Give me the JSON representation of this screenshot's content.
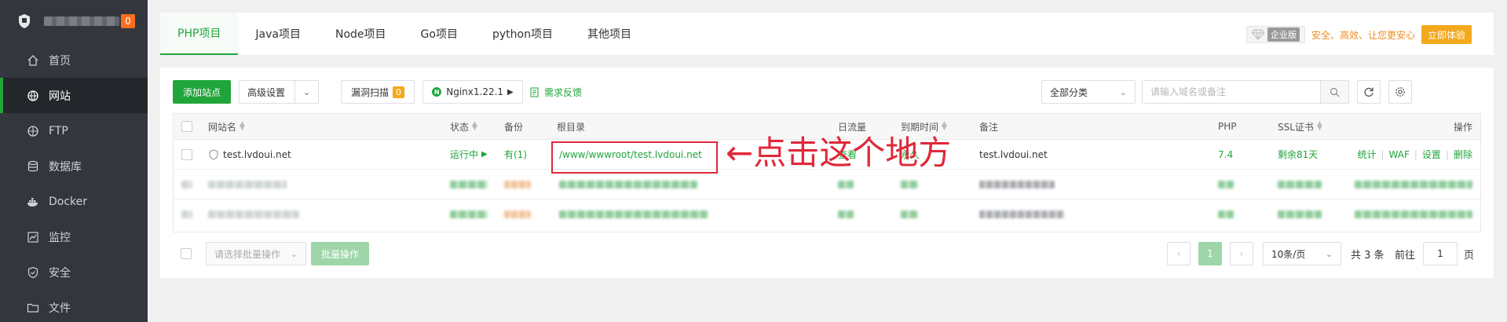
{
  "sidebar": {
    "badge": "0",
    "items": [
      {
        "label": "首页",
        "icon": "home-icon"
      },
      {
        "label": "网站",
        "icon": "globe-icon",
        "active": true
      },
      {
        "label": "FTP",
        "icon": "ftp-icon"
      },
      {
        "label": "数据库",
        "icon": "database-icon"
      },
      {
        "label": "Docker",
        "icon": "docker-icon"
      },
      {
        "label": "监控",
        "icon": "monitor-icon"
      },
      {
        "label": "安全",
        "icon": "shield-icon"
      },
      {
        "label": "文件",
        "icon": "folder-icon"
      }
    ]
  },
  "tabs": [
    "PHP项目",
    "Java项目",
    "Node项目",
    "Go项目",
    "python项目",
    "其他项目"
  ],
  "promo": {
    "tag": "企业版",
    "text": "安全、高效、让您更安心",
    "button": "立即体验"
  },
  "toolbar": {
    "add_site": "添加站点",
    "advanced": "高级设置",
    "vuln_scan": "漏洞扫描",
    "vuln_count": "0",
    "nginx": "Nginx1.22.1",
    "feedback": "需求反馈",
    "category": "全部分类",
    "search_placeholder": "请输入域名或备注"
  },
  "table": {
    "headers": {
      "name": "网站名",
      "status": "状态",
      "backup": "备份",
      "root": "根目录",
      "traffic": "日流量",
      "expire": "到期时间",
      "note": "备注",
      "php": "PHP",
      "ssl": "SSL证书",
      "ops": "操作"
    },
    "row": {
      "name": "test.lvdoui.net",
      "status": "运行中",
      "backup": "有(1)",
      "root": "/www/wwwroot/test.lvdoui.net",
      "traffic": "查看",
      "expire": "永久",
      "note": "test.lvdoui.net",
      "php": "7.4",
      "ssl": "剩余81天",
      "ops": [
        "统计",
        "WAF",
        "设置",
        "删除"
      ]
    }
  },
  "annotation": "←点击这个地方",
  "footer": {
    "batch_placeholder": "请选择批量操作",
    "batch_button": "批量操作",
    "current_page": "1",
    "page_size": "10条/页",
    "total": "共 3 条",
    "goto_label": "前往",
    "goto_value": "1",
    "page_suffix": "页"
  },
  "colors": {
    "accent": "#20a53a",
    "sidebar_bg": "#33373d",
    "annotation": "#e0283a",
    "badge": "#ff6d1f",
    "promo": "#f4a81d"
  }
}
